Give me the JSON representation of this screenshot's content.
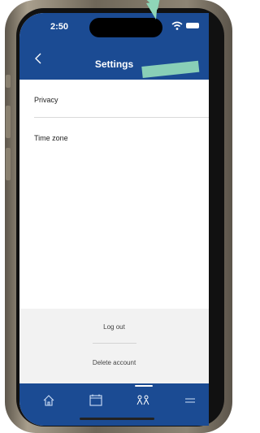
{
  "status_bar": {
    "time": "2:50"
  },
  "header": {
    "title": "Settings"
  },
  "settings_items": [
    {
      "label": "Privacy"
    },
    {
      "label": "Time zone"
    }
  ],
  "footer": {
    "logout_label": "Log out",
    "delete_label": "Delete account"
  },
  "tabbar": {
    "items": [
      {
        "icon": "home-icon"
      },
      {
        "icon": "calendar-icon"
      },
      {
        "icon": "people-icon",
        "active": true
      },
      {
        "icon": "menu-icon"
      }
    ]
  },
  "colors": {
    "primary": "#1b4b93",
    "accent_arrow": "#8fd6b8",
    "footer_bg": "#f2f2f2"
  }
}
